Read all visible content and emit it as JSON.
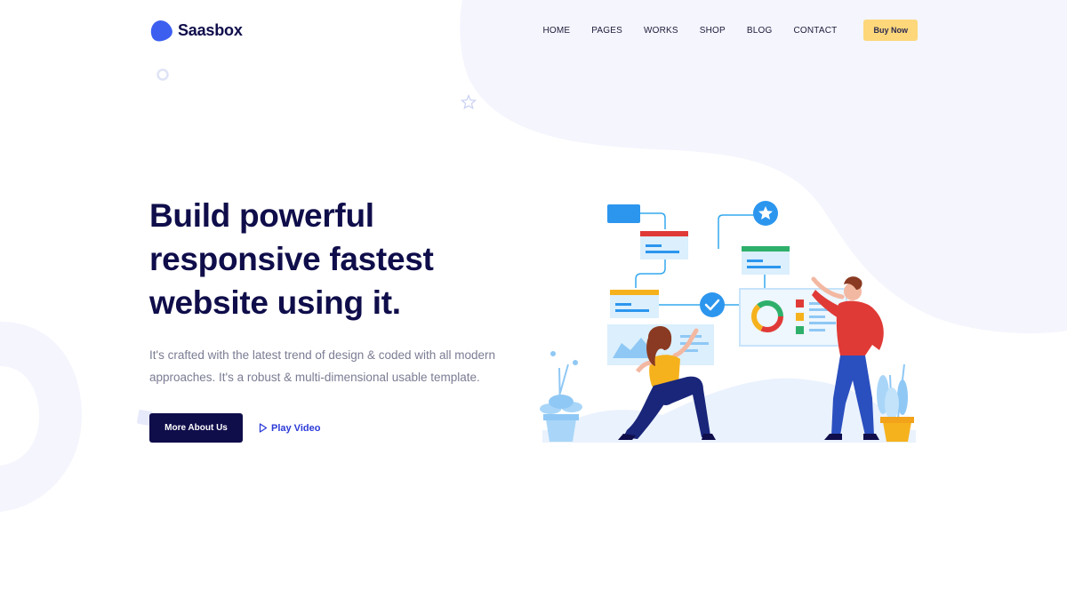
{
  "brand": {
    "name": "Saasbox",
    "logo_icon": "blob-logo-icon",
    "color": "#3c5ff0"
  },
  "nav": {
    "items": [
      "HOME",
      "PAGES",
      "WORKS",
      "SHOP",
      "BLOG",
      "CONTACT"
    ],
    "buy_label": "Buy Now"
  },
  "hero": {
    "title_line1": "Build powerful",
    "title_line2": "responsive fastest",
    "title_line3": "website using it.",
    "description": "It's crafted with the latest trend of design & coded with all modern approaches. It's a robust & multi-dimensional usable template.",
    "primary_label": "More About Us",
    "play_label": "Play Video",
    "play_icon": "play-triangle-icon"
  },
  "colors": {
    "navy": "#0f0d4a",
    "accent_yellow": "#fdd77a",
    "link_blue": "#2c3ad8",
    "blob": "#f4f5fd"
  }
}
